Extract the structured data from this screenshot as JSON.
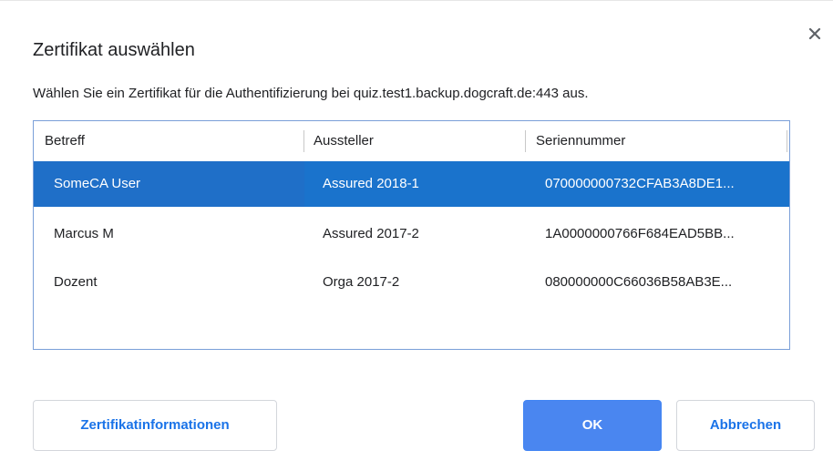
{
  "dialog": {
    "title": "Zertifikat auswählen",
    "description": "Wählen Sie ein Zertifikat für die Authentifizierung bei quiz.test1.backup.dogcraft.de:443 aus.",
    "close_icon": "close-icon"
  },
  "table": {
    "columns": [
      "Betreff",
      "Aussteller",
      "Seriennummer"
    ],
    "rows": [
      {
        "subject": "SomeCA User",
        "issuer": "Assured 2018-1",
        "serial": "070000000732CFAB3A8DE1...",
        "selected": true
      },
      {
        "subject": "Marcus M",
        "issuer": "Assured 2017-2",
        "serial": "1A0000000766F684EAD5BB...",
        "selected": false
      },
      {
        "subject": "Dozent",
        "issuer": "Orga 2017-2",
        "serial": "080000000C66036B58AB3E...",
        "selected": false
      }
    ]
  },
  "buttons": {
    "info": "Zertifikatinformationen",
    "ok": "OK",
    "cancel": "Abbrechen"
  },
  "colors": {
    "selection": "#1a73cc",
    "primary_button": "#4a86f0",
    "link_text": "#1a73e8",
    "table_border": "#7a9fd8"
  }
}
